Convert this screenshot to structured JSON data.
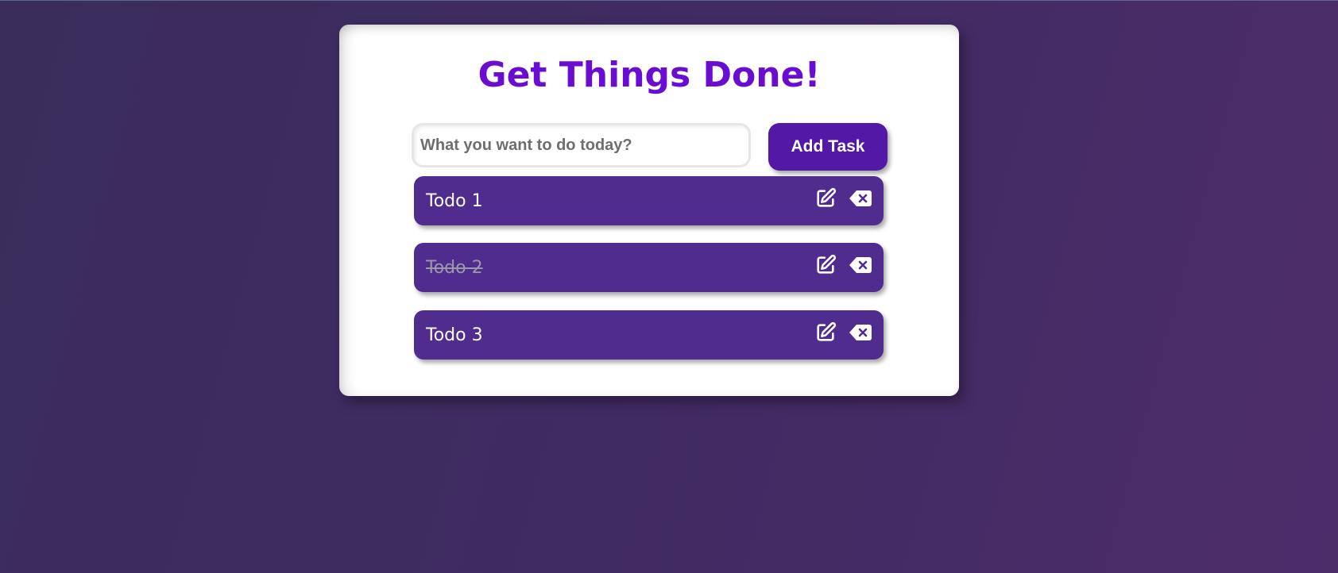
{
  "app": {
    "title": "Get Things Done!"
  },
  "form": {
    "input_value": "",
    "input_placeholder": "What you want to do today?",
    "add_label": "Add Task"
  },
  "todos": [
    {
      "text": "Todo 1",
      "completed": false
    },
    {
      "text": "Todo 2",
      "completed": true
    },
    {
      "text": "Todo 3",
      "completed": false
    }
  ],
  "icons": {
    "edit": "pen-to-square-icon",
    "delete": "delete-left-icon"
  },
  "colors": {
    "title": "#6a0dd2",
    "accent": "#5119a6",
    "todo_bg": "#512c8f",
    "completed_text": "#9b96a8"
  }
}
